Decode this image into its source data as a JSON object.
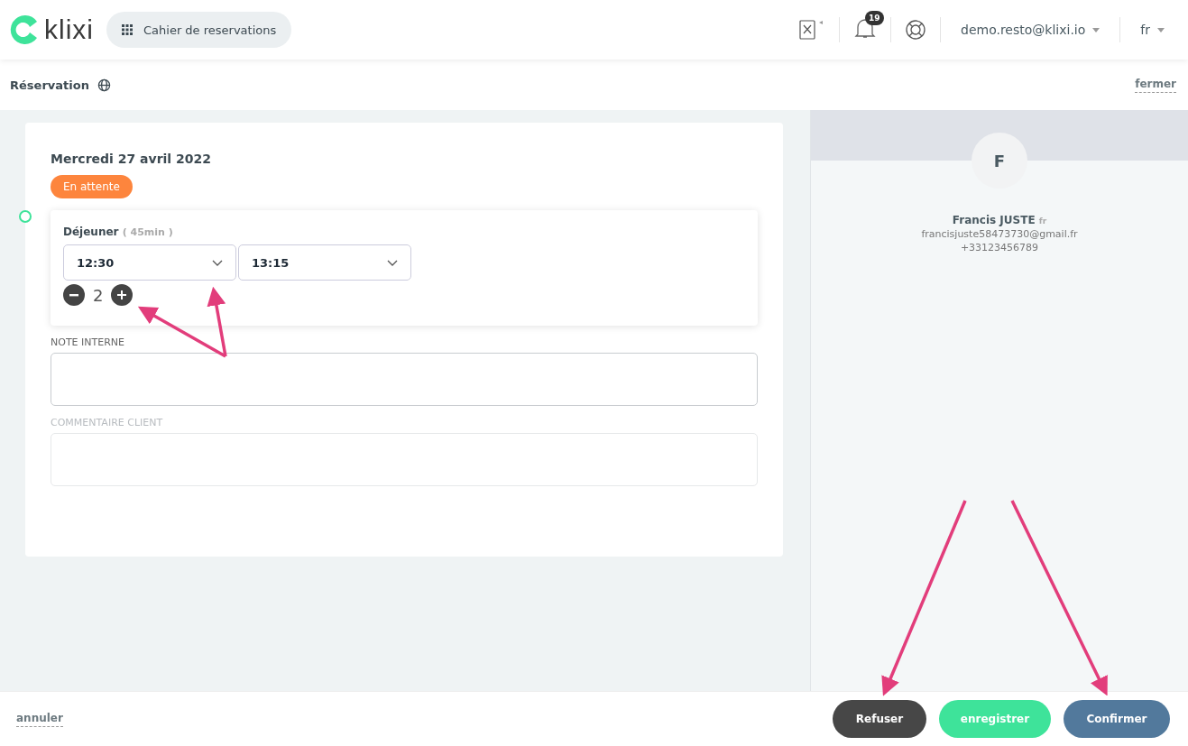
{
  "header": {
    "logo": "klixi",
    "app_button": "Cahier de reservations",
    "notifications": "19",
    "user": "demo.resto@klixi.io",
    "language": "fr"
  },
  "subheader": {
    "title": "Réservation",
    "close": "fermer"
  },
  "reservation": {
    "date": "Mercredi 27 avril 2022",
    "status": "En attente",
    "service": {
      "name": "Déjeuner",
      "duration": "( 45min )",
      "start": "12:30",
      "end": "13:15",
      "guests": "2"
    },
    "fields": [
      {
        "label": "NOTE INTERNE",
        "disabled": false
      },
      {
        "label": "COMMENTAIRE CLIENT",
        "disabled": true
      }
    ]
  },
  "customer": {
    "initial": "F",
    "name": "Francis JUSTE",
    "language": "fr",
    "email": "francisjuste58473730@gmail.fr",
    "phone": "+33123456789"
  },
  "footer": {
    "cancel": "annuler",
    "buttons": [
      {
        "label": "Refuser",
        "kind": "refuse"
      },
      {
        "label": "enregistrer",
        "kind": "save"
      },
      {
        "label": "Confirmer",
        "kind": "confirm"
      }
    ]
  }
}
